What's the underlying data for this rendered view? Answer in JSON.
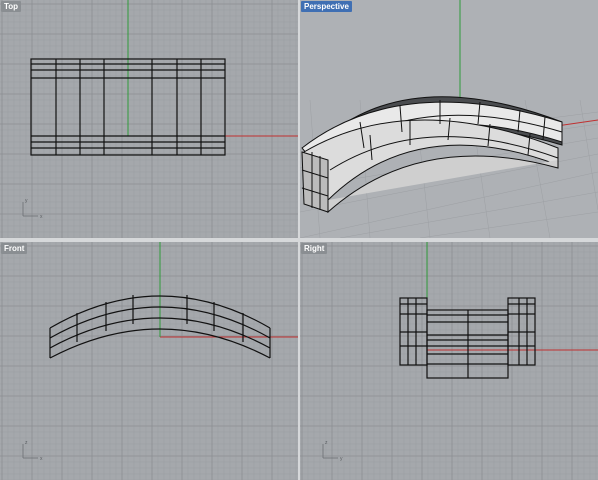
{
  "viewports": {
    "top": {
      "label": "Top",
      "axis_h": "x",
      "axis_v": "y"
    },
    "perspective": {
      "label": "Perspective",
      "active": true
    },
    "front": {
      "label": "Front",
      "axis_h": "x",
      "axis_v": "z"
    },
    "right": {
      "label": "Right",
      "axis_h": "y",
      "axis_v": "z"
    }
  },
  "colors": {
    "viewport_bg": "#a5a8ac",
    "grid_minor": "#9a9da1",
    "grid_major": "#8c8f93",
    "axis_x": "#c03030",
    "axis_y": "#2f9a3a",
    "active_label": "#3f6fb3",
    "curve": "#111111",
    "surface_light": "#e9e9e9",
    "surface_dark": "#4a4c4f"
  }
}
